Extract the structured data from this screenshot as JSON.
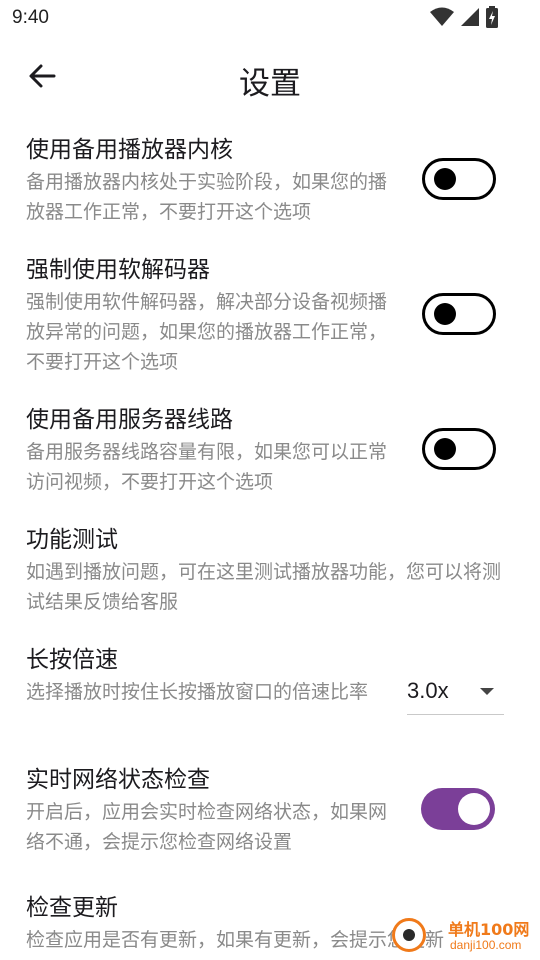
{
  "status_bar": {
    "time": "9:40",
    "icons": [
      "wifi-icon",
      "cell-signal-icon",
      "battery-icon"
    ]
  },
  "header": {
    "title": "设置",
    "back_icon": "arrow-back-icon"
  },
  "settings": [
    {
      "title": "使用备用播放器内核",
      "desc": "备用播放器内核处于实验阶段，如果您的播放器工作正常，不要打开这个选项",
      "control": "switch",
      "enabled": false
    },
    {
      "title": "强制使用软解码器",
      "desc": "强制使用软件解码器，解决部分设备视频播放异常的问题，如果您的播放器工作正常，不要打开这个选项",
      "control": "switch",
      "enabled": false
    },
    {
      "title": "使用备用服务器线路",
      "desc": "备用服务器线路容量有限，如果您可以正常访问视频，不要打开这个选项",
      "control": "switch",
      "enabled": false
    },
    {
      "title": "功能测试",
      "desc": "如遇到播放问题，可在这里测试播放器功能，您可以将测试结果反馈给客服",
      "control": "none"
    },
    {
      "title": "长按倍速",
      "desc": "选择播放时按住长按播放窗口的倍速比率",
      "control": "dropdown",
      "value": "3.0x"
    },
    {
      "title": "实时网络状态检查",
      "desc": "开启后，应用会实时检查网络状态，如果网络不通，会提示您检查网络设置",
      "control": "switch",
      "enabled": true
    },
    {
      "title": "检查更新",
      "desc": "检查应用是否有更新，如果有更新，会提示您更新",
      "control": "none"
    }
  ],
  "colors": {
    "accent": "#7b3f98",
    "text_primary": "#1c1b1f",
    "text_secondary": "#8a8a8a"
  },
  "watermark": {
    "title": "单机100网",
    "url": "danji100.com"
  }
}
